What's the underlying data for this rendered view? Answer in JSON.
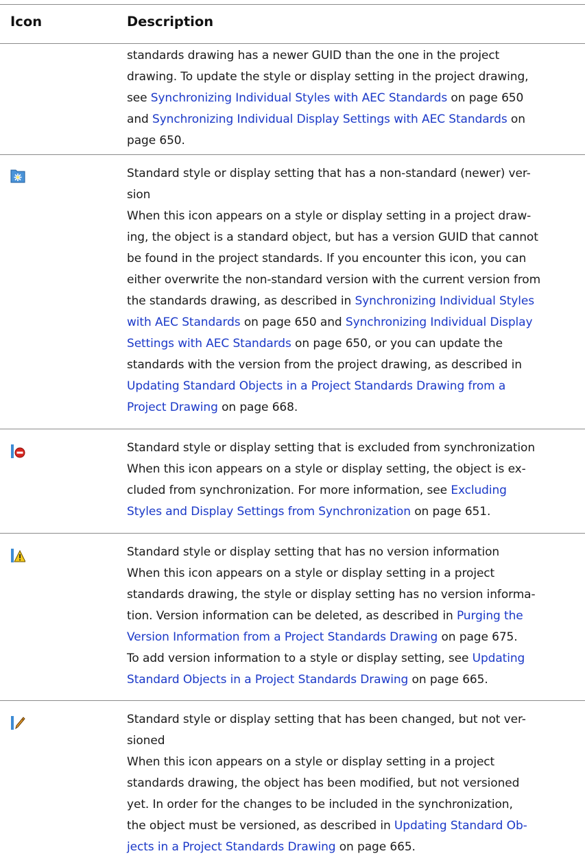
{
  "table": {
    "header": {
      "icon_col": "Icon",
      "desc_col": "Description"
    },
    "rows": [
      {
        "icon": null,
        "lines": [
          [
            {
              "t": "standards drawing has a newer GUID than the one in the project"
            }
          ],
          [
            {
              "t": "drawing. To update the style or display setting in the project drawing,"
            }
          ],
          [
            {
              "t": "see "
            },
            {
              "t": "Synchronizing Individual Styles with AEC Standards",
              "link": true
            },
            {
              "t": " on page 650"
            }
          ],
          [
            {
              "t": "and "
            },
            {
              "t": "Synchronizing Individual Display Settings with AEC Standards",
              "link": true
            },
            {
              "t": " on"
            }
          ],
          [
            {
              "t": "page 650."
            }
          ]
        ]
      },
      {
        "icon": "newer-version-sparkle-icon",
        "lines": [
          [
            {
              "t": "Standard style or display setting that has a non-standard (newer) ver-"
            }
          ],
          [
            {
              "t": "sion"
            }
          ],
          [
            {
              "t": "When this icon appears on a style or display setting in a project draw-"
            }
          ],
          [
            {
              "t": "ing, the object is a standard object, but has a version GUID that cannot"
            }
          ],
          [
            {
              "t": "be found in the project standards. If you encounter this icon, you can"
            }
          ],
          [
            {
              "t": "either overwrite the non-standard version with the current version from"
            }
          ],
          [
            {
              "t": "the standards drawing, as described in "
            },
            {
              "t": "Synchronizing Individual Styles",
              "link": true
            }
          ],
          [
            {
              "t": "with AEC Standards",
              "link": true
            },
            {
              "t": " on page 650 and "
            },
            {
              "t": "Synchronizing Individual Display",
              "link": true
            }
          ],
          [
            {
              "t": "Settings with AEC Standards",
              "link": true
            },
            {
              "t": " on page 650, or you can update the"
            }
          ],
          [
            {
              "t": "standards with the version from the project drawing, as described in"
            }
          ],
          [
            {
              "t": "Updating Standard Objects in a Project Standards Drawing from a",
              "link": true
            }
          ],
          [
            {
              "t": "Project Drawing",
              "link": true
            },
            {
              "t": " on page 668."
            }
          ]
        ]
      },
      {
        "icon": "excluded-no-entry-icon",
        "lines": [
          [
            {
              "t": "Standard style or display setting that is excluded from synchronization"
            }
          ],
          [
            {
              "t": "When this icon appears on a style or display setting, the object is ex-"
            }
          ],
          [
            {
              "t": "cluded from synchronization. For more information, see "
            },
            {
              "t": "Excluding",
              "link": true
            }
          ],
          [
            {
              "t": "Styles and Display Settings from Synchronization",
              "link": true
            },
            {
              "t": " on page 651."
            }
          ]
        ]
      },
      {
        "icon": "no-version-warning-icon",
        "lines": [
          [
            {
              "t": "Standard style or display setting that has no version information"
            }
          ],
          [
            {
              "t": "When this icon appears on a style or display setting in a project"
            }
          ],
          [
            {
              "t": "standards drawing, the style or display setting has no version informa-"
            }
          ],
          [
            {
              "t": "tion. Version information can be deleted, as described in "
            },
            {
              "t": "Purging the",
              "link": true
            }
          ],
          [
            {
              "t": "Version Information from a Project Standards Drawing",
              "link": true
            },
            {
              "t": " on page 675."
            }
          ],
          [
            {
              "t": "To add version information to a style or display setting, see "
            },
            {
              "t": "Updating",
              "link": true
            }
          ],
          [
            {
              "t": "Standard Objects in a Project Standards Drawing",
              "link": true
            },
            {
              "t": " on page 665."
            }
          ]
        ]
      },
      {
        "icon": "changed-not-versioned-pencil-icon",
        "lines": [
          [
            {
              "t": "Standard style or display setting that has been changed, but not ver-"
            }
          ],
          [
            {
              "t": "sioned"
            }
          ],
          [
            {
              "t": "When this icon appears on a style or display setting in a project"
            }
          ],
          [
            {
              "t": "standards drawing, the object has been modified, but not versioned"
            }
          ],
          [
            {
              "t": "yet. In order for the changes to be included in the synchronization,"
            }
          ],
          [
            {
              "t": "the object must be versioned, as described in "
            },
            {
              "t": "Updating Standard Ob-",
              "link": true
            }
          ],
          [
            {
              "t": "jects in a Project Standards Drawing",
              "link": true
            },
            {
              "t": " on page 665."
            }
          ]
        ]
      }
    ]
  },
  "colors": {
    "text": "#1a1a1a",
    "link": "#1b39c8",
    "rule": "#8a8a8a",
    "icon_blue": "#3d8bd4"
  }
}
